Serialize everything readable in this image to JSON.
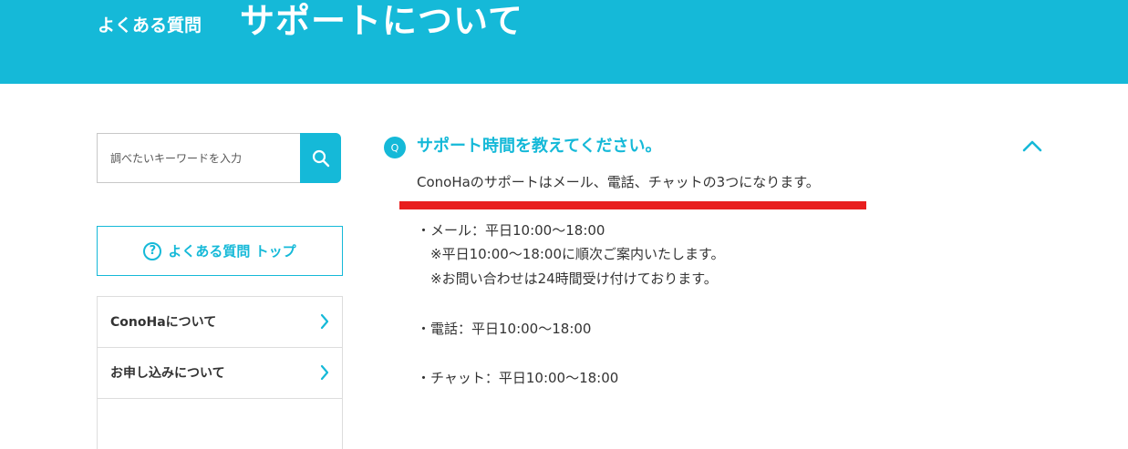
{
  "header": {
    "subtitle": "よくある質問",
    "title": "サポートについて"
  },
  "sidebar": {
    "search": {
      "placeholder": "調べたいキーワードを入力",
      "icon": "search-icon"
    },
    "faq_top_label": "よくある質問 トップ",
    "faq_top_icon_glyph": "?",
    "categories": [
      {
        "label": "ConoHaについて"
      },
      {
        "label": "お申し込みについて"
      }
    ]
  },
  "faq": {
    "q_badge": "Q",
    "question": "サポート時間を教えてください。",
    "answer_lead": "ConoHaのサポートはメール、電話、チャットの3つになります。",
    "lines": [
      "・メール：平日10:00～18:00",
      "　※平日10:00～18:00に順次ご案内いたします。",
      "　※お問い合わせは24時間受け付けております。",
      "・電話：平日10:00～18:00",
      "・チャット：平日10:00～18:00"
    ]
  },
  "colors": {
    "brand": "#15b9d8",
    "highlight": "#e81e1e",
    "text": "#333333"
  }
}
